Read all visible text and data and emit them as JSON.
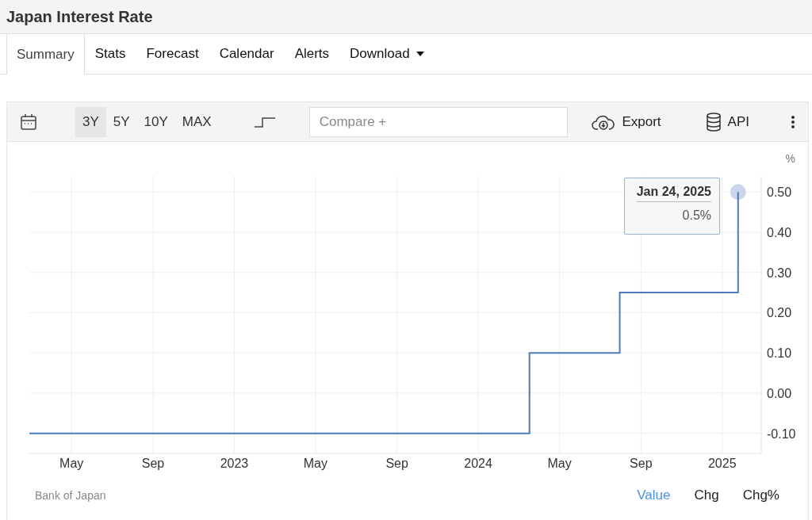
{
  "title": "Japan Interest Rate",
  "tabs": [
    {
      "label": "Summary",
      "selected": true,
      "kind": "tab"
    },
    {
      "label": "Stats",
      "selected": false,
      "kind": "tab"
    },
    {
      "label": "Forecast",
      "selected": false,
      "kind": "tab"
    },
    {
      "label": "Calendar",
      "selected": false,
      "kind": "tab"
    },
    {
      "label": "Alerts",
      "selected": false,
      "kind": "tab"
    },
    {
      "label": "Download",
      "selected": false,
      "kind": "dropdown"
    }
  ],
  "toolbar": {
    "ranges": [
      {
        "label": "3Y",
        "selected": true
      },
      {
        "label": "5Y",
        "selected": false
      },
      {
        "label": "10Y",
        "selected": false
      },
      {
        "label": "MAX",
        "selected": false
      }
    ],
    "compare": {
      "placeholder": "Compare +"
    },
    "export": "Export",
    "api": "API"
  },
  "chart": {
    "unit": "%",
    "tooltip": {
      "date": "Jan 24, 2025",
      "value": "0.5%"
    },
    "chart_data": {
      "type": "line",
      "x": [
        2022.16,
        2024.21,
        2024.21,
        2024.58,
        2024.58,
        2025.065,
        2025.065
      ],
      "grid": true,
      "series": [
        {
          "color": "#4f79bd",
          "values": [
            -0.1,
            -0.1,
            0.1,
            0.1,
            0.25,
            0.25,
            0.5
          ]
        }
      ],
      "xlim": [
        2022.16,
        2025.16
      ],
      "ylim": [
        -0.15,
        0.54
      ],
      "xticks": [
        {
          "value": 2022.333,
          "label": "May"
        },
        {
          "value": 2022.667,
          "label": "Sep"
        },
        {
          "value": 2023,
          "label": "2023"
        },
        {
          "value": 2023.333,
          "label": "May"
        },
        {
          "value": 2023.667,
          "label": "Sep"
        },
        {
          "value": 2024,
          "label": "2024"
        },
        {
          "value": 2024.333,
          "label": "May"
        },
        {
          "value": 2024.667,
          "label": "Sep"
        },
        {
          "value": 2025,
          "label": "2025"
        }
      ],
      "yticks": [
        {
          "value": -0.1,
          "label": "-0.10"
        },
        {
          "value": 0,
          "label": "0.00"
        },
        {
          "value": 0.1,
          "label": "0.10"
        },
        {
          "value": 0.2,
          "label": "0.20"
        },
        {
          "value": 0.3,
          "label": "0.30"
        },
        {
          "value": 0.4,
          "label": "0.40"
        },
        {
          "value": 0.5,
          "label": "0.50"
        }
      ]
    }
  },
  "footer": {
    "source": "Bank of Japan",
    "modes": [
      {
        "label": "Value",
        "selected": true
      },
      {
        "label": "Chg",
        "selected": false
      },
      {
        "label": "Chg%",
        "selected": false
      }
    ]
  }
}
